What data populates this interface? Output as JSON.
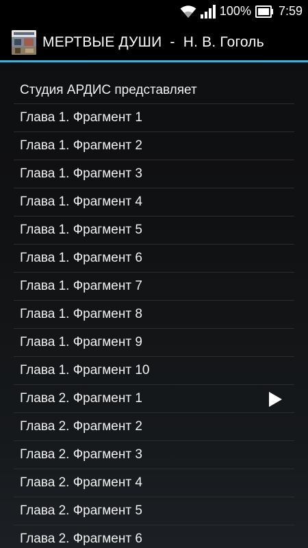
{
  "status_bar": {
    "wifi_icon": "wifi-icon",
    "signal_icon": "cell-signal-icon",
    "battery_percent": "100%",
    "battery_icon": "battery-icon",
    "time": "7:59"
  },
  "app_bar": {
    "icon": "book-cover-icon",
    "title": "МЕРТВЫЕ ДУШИ  -  Н. В. Гоголь",
    "accent_color": "#33b5e5"
  },
  "tracks": [
    {
      "label": "Студия АРДИС представляет"
    },
    {
      "label": "Глава 1. Фрагмент 1"
    },
    {
      "label": "Глава 1. Фрагмент 2"
    },
    {
      "label": "Глава 1. Фрагмент 3"
    },
    {
      "label": "Глава 1. Фрагмент 4"
    },
    {
      "label": "Глава 1. Фрагмент 5"
    },
    {
      "label": "Глава 1. Фрагмент 6"
    },
    {
      "label": "Глава 1. Фрагмент 7"
    },
    {
      "label": "Глава 1. Фрагмент 8"
    },
    {
      "label": "Глава 1. Фрагмент 9"
    },
    {
      "label": "Глава 1. Фрагмент 10"
    },
    {
      "label": "Глава 2. Фрагмент 1",
      "playing": true,
      "icon": "play-icon"
    },
    {
      "label": "Глава 2. Фрагмент 2"
    },
    {
      "label": "Глава 2. Фрагмент 3"
    },
    {
      "label": "Глава 2. Фрагмент 4"
    },
    {
      "label": "Глава 2. Фрагмент 5"
    },
    {
      "label": "Глава 2. Фрагмент 6"
    }
  ]
}
